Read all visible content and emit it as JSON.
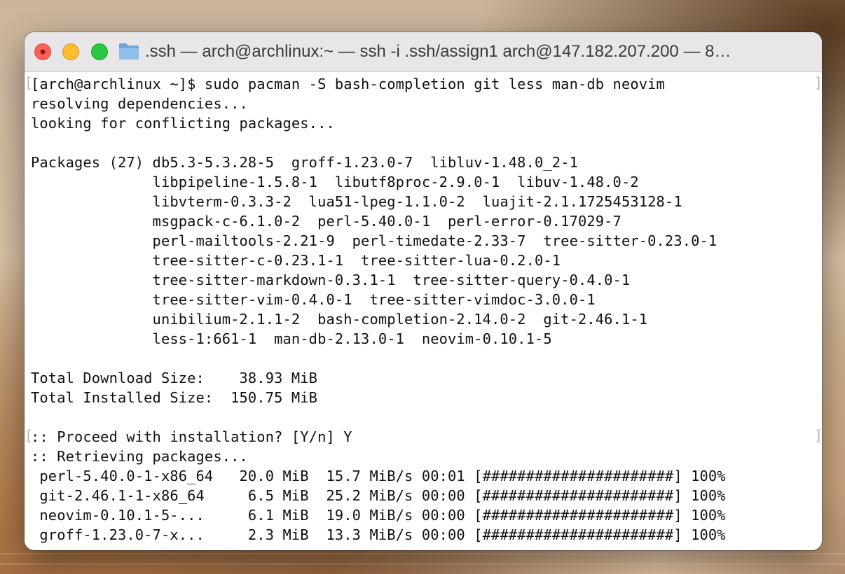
{
  "window": {
    "title": ".ssh — arch@archlinux:~ — ssh -i .ssh/assign1 arch@147.182.207.200 — 8…",
    "icons": {
      "close": "close-icon",
      "minimize": "minimize-icon",
      "maximize": "maximize-icon",
      "folder": "folder-icon"
    },
    "colors": {
      "close": "#fe5f57",
      "minimize": "#febc2e",
      "maximize": "#28c840",
      "folder": "#7fb3e3"
    }
  },
  "terminal": {
    "lines": [
      "[arch@archlinux ~]$ sudo pacman -S bash-completion git less man-db neovim",
      "resolving dependencies...",
      "looking for conflicting packages...",
      "",
      "Packages (27) db5.3-5.3.28-5  groff-1.23.0-7  libluv-1.48.0_2-1",
      "              libpipeline-1.5.8-1  libutf8proc-2.9.0-1  libuv-1.48.0-2",
      "              libvterm-0.3.3-2  lua51-lpeg-1.1.0-2  luajit-2.1.1725453128-1",
      "              msgpack-c-6.1.0-2  perl-5.40.0-1  perl-error-0.17029-7",
      "              perl-mailtools-2.21-9  perl-timedate-2.33-7  tree-sitter-0.23.0-1",
      "              tree-sitter-c-0.23.1-1  tree-sitter-lua-0.2.0-1",
      "              tree-sitter-markdown-0.3.1-1  tree-sitter-query-0.4.0-1",
      "              tree-sitter-vim-0.4.0-1  tree-sitter-vimdoc-3.0.0-1",
      "              unibilium-2.1.1-2  bash-completion-2.14.0-2  git-2.46.1-1",
      "              less-1:661-1  man-db-2.13.0-1  neovim-0.10.1-5",
      "",
      "Total Download Size:    38.93 MiB",
      "Total Installed Size:  150.75 MiB",
      "",
      ":: Proceed with installation? [Y/n] Y",
      ":: Retrieving packages...",
      " perl-5.40.0-1-x86_64   20.0 MiB  15.7 MiB/s 00:01 [######################] 100%",
      " git-2.46.1-1-x86_64     6.5 MiB  25.2 MiB/s 00:00 [######################] 100%",
      " neovim-0.10.1-5-...     6.1 MiB  19.0 MiB/s 00:00 [######################] 100%",
      " groff-1.23.0-7-x...     2.3 MiB  13.3 MiB/s 00:00 [######################] 100%"
    ],
    "mark_open": "[",
    "mark_close": "]"
  }
}
